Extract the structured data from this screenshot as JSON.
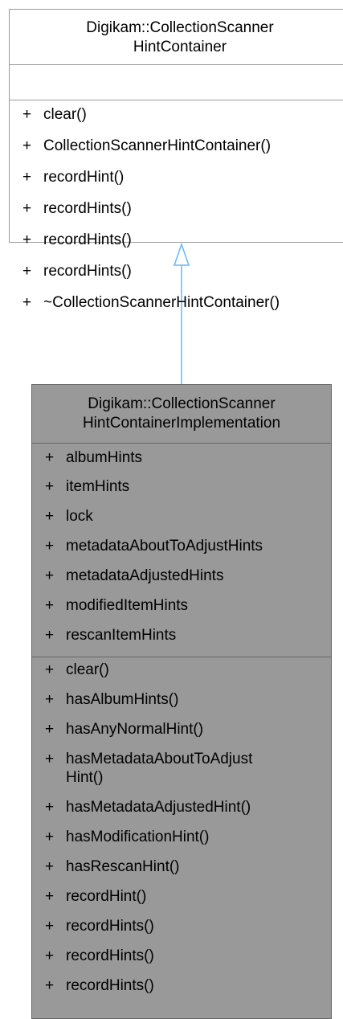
{
  "base_class": {
    "title_line1": "Digikam::CollectionScanner",
    "title_line2": "HintContainer",
    "attributes": [],
    "methods": [
      {
        "vis": "+",
        "name": "clear()"
      },
      {
        "vis": "+",
        "name": "CollectionScannerHintContainer()"
      },
      {
        "vis": "+",
        "name": "recordHint()"
      },
      {
        "vis": "+",
        "name": "recordHints()"
      },
      {
        "vis": "+",
        "name": "recordHints()"
      },
      {
        "vis": "+",
        "name": "recordHints()"
      },
      {
        "vis": "+",
        "name": "~CollectionScannerHintContainer()"
      }
    ]
  },
  "derived_class": {
    "title_line1": "Digikam::CollectionScanner",
    "title_line2": "HintContainerImplementation",
    "attributes": [
      {
        "vis": "+",
        "name": "albumHints"
      },
      {
        "vis": "+",
        "name": "itemHints"
      },
      {
        "vis": "+",
        "name": "lock"
      },
      {
        "vis": "+",
        "name": "metadataAboutToAdjustHints"
      },
      {
        "vis": "+",
        "name": "metadataAdjustedHints"
      },
      {
        "vis": "+",
        "name": "modifiedItemHints"
      },
      {
        "vis": "+",
        "name": "rescanItemHints"
      }
    ],
    "methods": [
      {
        "vis": "+",
        "name": "clear()"
      },
      {
        "vis": "+",
        "name": "hasAlbumHints()"
      },
      {
        "vis": "+",
        "name": "hasAnyNormalHint()"
      },
      {
        "vis": "+",
        "name": "hasMetadataAboutToAdjust",
        "name_cont": "Hint()"
      },
      {
        "vis": "+",
        "name": "hasMetadataAdjustedHint()"
      },
      {
        "vis": "+",
        "name": "hasModificationHint()"
      },
      {
        "vis": "+",
        "name": "hasRescanHint()"
      },
      {
        "vis": "+",
        "name": "recordHint()"
      },
      {
        "vis": "+",
        "name": "recordHints()"
      },
      {
        "vis": "+",
        "name": "recordHints()"
      },
      {
        "vis": "+",
        "name": "recordHints()"
      }
    ]
  },
  "colors": {
    "base_fill": "#ffffff",
    "base_border": "#999999",
    "derived_fill": "#999999",
    "derived_border": "#666666",
    "inheritance_arrow": "#63b8ff"
  },
  "relationship": "inheritance"
}
